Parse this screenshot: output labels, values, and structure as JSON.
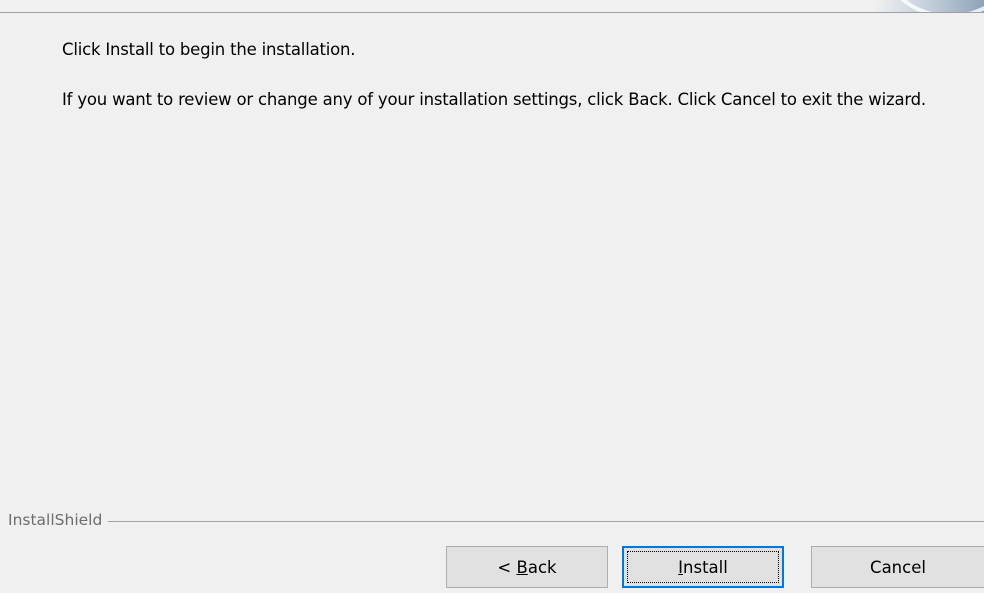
{
  "instructions": {
    "line1": "Click Install to begin the installation.",
    "line2": "If you want to review or change any of your installation settings, click Back. Click Cancel to exit the wizard."
  },
  "footer": {
    "brand": "InstallShield"
  },
  "buttons": {
    "back_prefix": "< ",
    "back_mnemonic": "B",
    "back_rest": "ack",
    "install_mnemonic": "I",
    "install_rest": "nstall",
    "cancel": "Cancel"
  },
  "colors": {
    "background": "#f0f0f0",
    "focus_border": "#0078d7",
    "button_face": "#e1e1e1"
  }
}
